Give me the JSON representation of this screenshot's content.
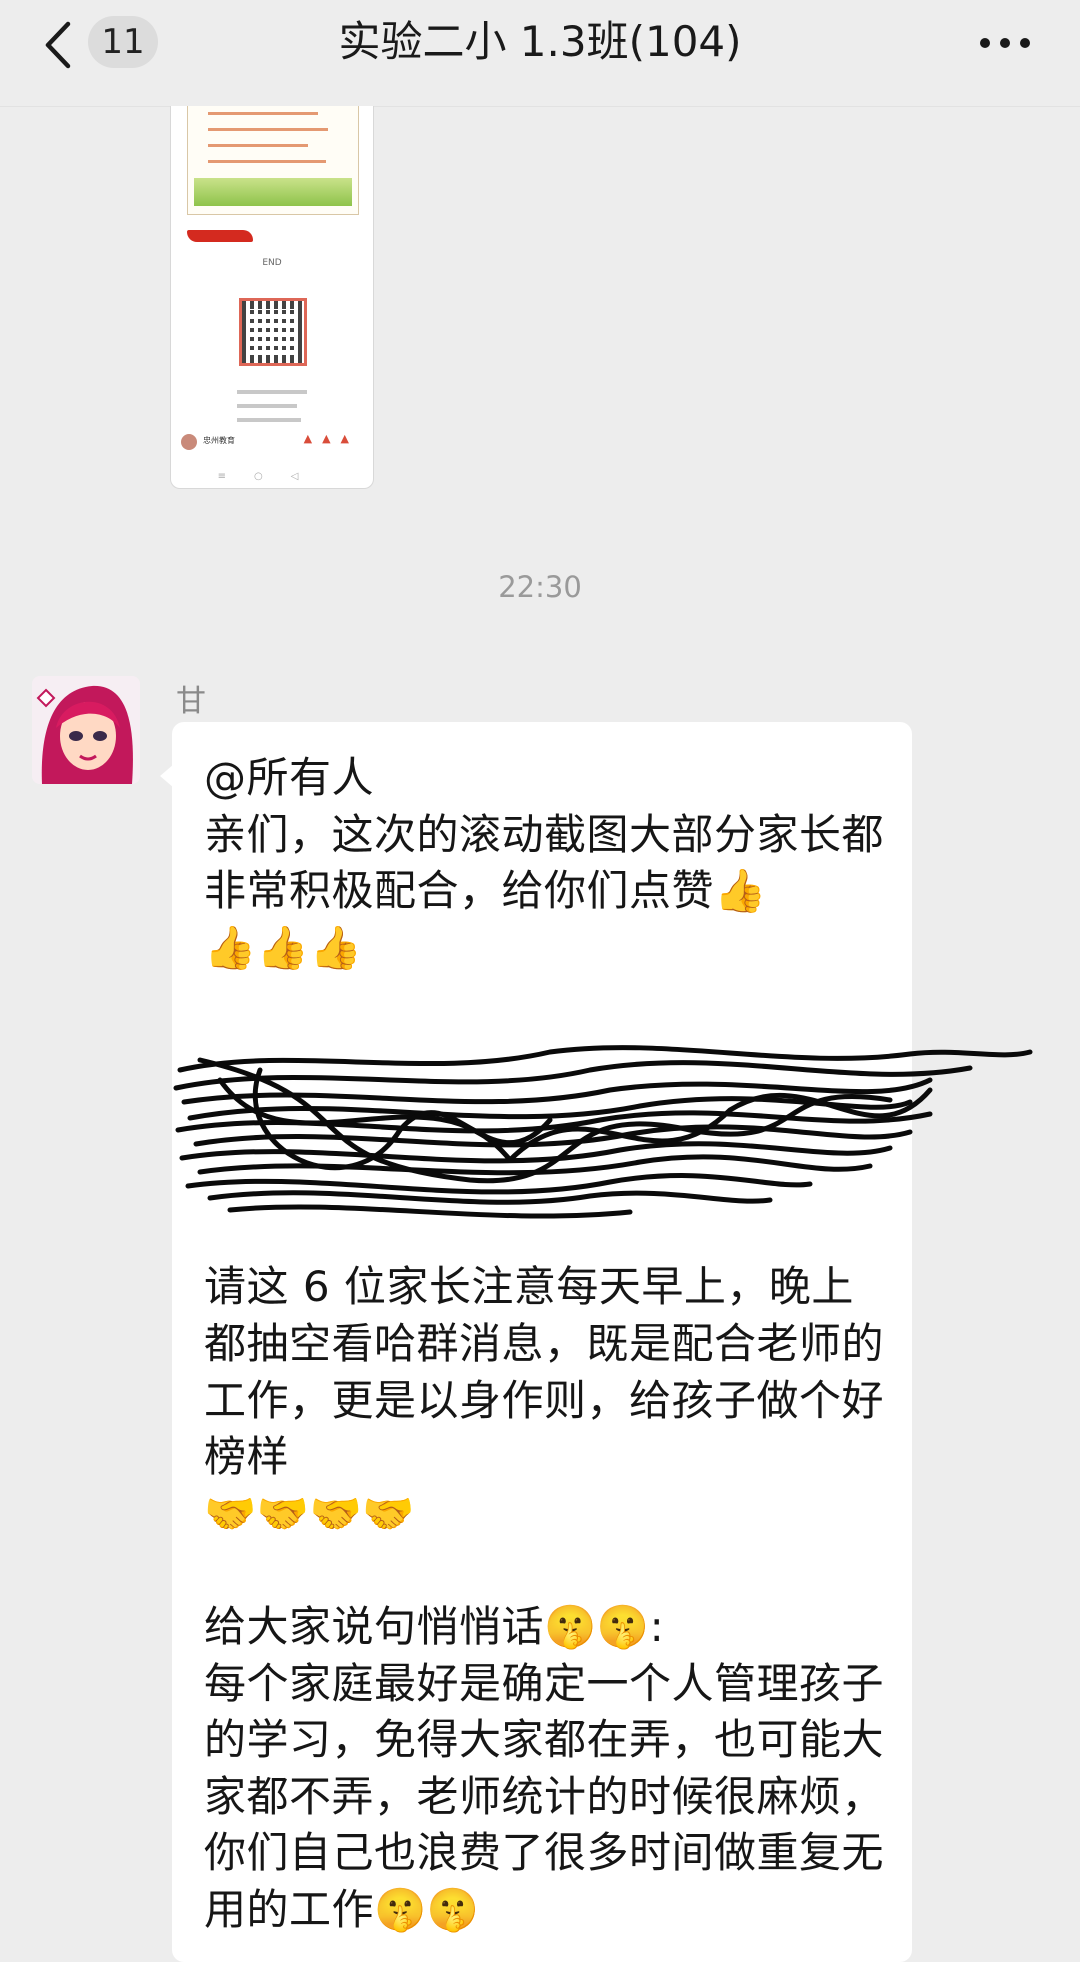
{
  "header": {
    "unread_count": "11",
    "title": "实验二小 1.3班(104)"
  },
  "shared_card": {
    "end_label": "END",
    "footer_account": "忠州教育"
  },
  "timestamp": "22:30",
  "message": {
    "sender": "甘",
    "text": "@所有人\n亲们，这次的滚动截图大部分家长都非常积极配合，给你们点赞👍\n👍👍👍\n\n\n\n\n\n请这 6 位家长注意每天早上，晚上都抽空看哈群消息，既是配合老师的工作，更是以身作则，给孩子做个好榜样\n🤝🤝🤝🤝\n\n给大家说句悄悄话🤫🤫:\n每个家庭最好是确定一个人管理孩子的学习，免得大家都在弄，也可能大家都不弄，老师统计的时候很麻烦，你们自己也浪费了很多时间做重复无用的工作🤫🤫"
  },
  "colors": {
    "background": "#ededed",
    "bubble": "#ffffff",
    "badge": "#dcdcdc"
  }
}
